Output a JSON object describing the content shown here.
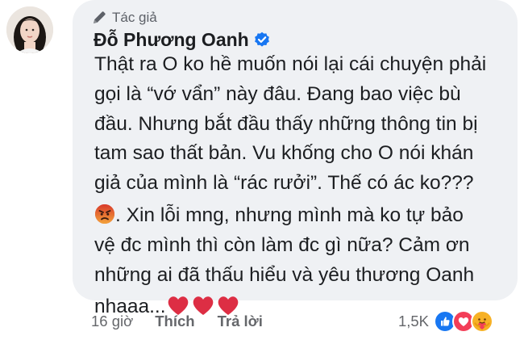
{
  "comment": {
    "author_badge": "Tác giả",
    "author_name": "Đỗ Phương Oanh",
    "author_verified": true,
    "text_lines_1": [
      "Thật ra O ko hề muốn nói lại cái chuyện phải",
      "gọi là “vớ vẩn” này đâu. Đang bao việc bù",
      "đầu. Nhưng bắt đầu thấy những thông tin bị",
      "tam sao thất bản. Vu khống cho O nói khán",
      "giả của mình là “rác rưởi”. Thế có ác ko???"
    ],
    "text_line_2_first": ". Xin lỗi mng, nhưng mình mà ko tự bảo",
    "text_lines_2": [
      "vệ đc mình thì còn làm đc gì nữa? Cảm ơn",
      "những ai đã thấu hiểu và yêu thương Oanh"
    ],
    "text_line_last": "nhaaa...",
    "emoji_start": "angry-face-icon",
    "emoji_end": [
      "heart-icon",
      "heart-icon",
      "heart-icon"
    ]
  },
  "actions": {
    "time": "16 giờ",
    "like_label": "Thích",
    "reply_label": "Trả lời"
  },
  "reactions": {
    "count": "1,5K",
    "icons": [
      "like-reaction-icon",
      "love-reaction-icon",
      "care-reaction-icon"
    ]
  },
  "colors": {
    "bubble_bg": "#eff1f4",
    "verified_blue": "#1877f2",
    "heart_red": "#dd2e44",
    "muted_text": "#65676b"
  }
}
